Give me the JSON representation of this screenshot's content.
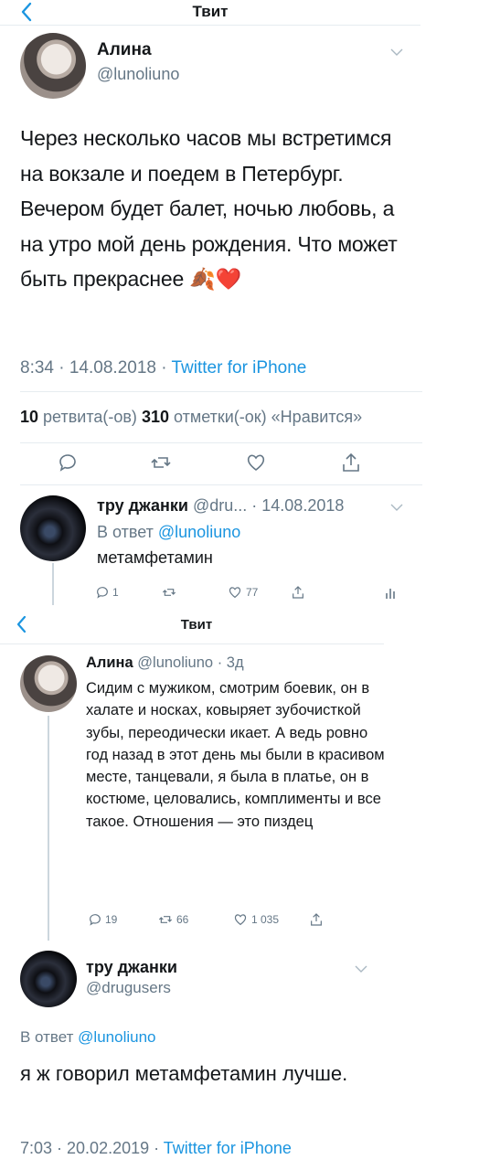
{
  "header1": {
    "title": "Твит"
  },
  "tweet": {
    "author_name": "Алина",
    "author_handle": "@lunoliuno",
    "text": "Через несколько часов мы встретимся на вокзале и поедем в Петербург. Вечером будет балет, ночью любовь, а на утро мой день рождения. Что может быть прекраснее",
    "emoji": "🍂❤️",
    "time": "8:34 · 14.08.2018 · ",
    "source": "Twitter for iPhone",
    "retweets_count": "10",
    "retweets_label": " ретвита(-ов) ",
    "likes_count": "310",
    "likes_label": " отметки(-ок) «Нравится»"
  },
  "reply1": {
    "author_name": "тру джанки",
    "author_handle": "@dru...",
    "date": "· 14.08.2018",
    "in_reply_prefix": "В ответ ",
    "in_reply_handle": "@lunoliuno",
    "text": "метамфетамин",
    "reply_count": "1",
    "like_count": "77"
  },
  "header2": {
    "title": "Твит"
  },
  "tweet2": {
    "author_name": "Алина",
    "author_handle": "@lunoliuno",
    "age": "· 3д",
    "text": "Сидим с мужиком, смотрим боевик, он в халате и носках, ковыряет зубочисткой зубы, переодически икает. А ведь ровно год назад в этот день мы были в красивом месте, танцевали, я была в платье, он в костюме, целовались, комплименты и все такое. Отношения — это пиздец",
    "reply_count": "19",
    "retweet_count": "66",
    "like_count": "1 035"
  },
  "reply2": {
    "author_name": "тру джанки",
    "author_handle": "@drugusers",
    "in_reply_prefix": "В ответ ",
    "in_reply_handle": "@lunoliuno",
    "text": "я ж говорил метамфетамин лучше.",
    "time": "7:03 · 20.02.2019 · ",
    "source": "Twitter for iPhone"
  },
  "icons": {
    "back": "chevron-left-icon",
    "reply": "reply-icon",
    "retweet": "retweet-icon",
    "like": "heart-icon",
    "share": "share-icon",
    "more": "chevron-down-icon",
    "analytics": "analytics-icon"
  },
  "colors": {
    "link": "#1b95e0",
    "meta": "#657786",
    "text": "#14171a",
    "divider": "#e6ecf0"
  }
}
